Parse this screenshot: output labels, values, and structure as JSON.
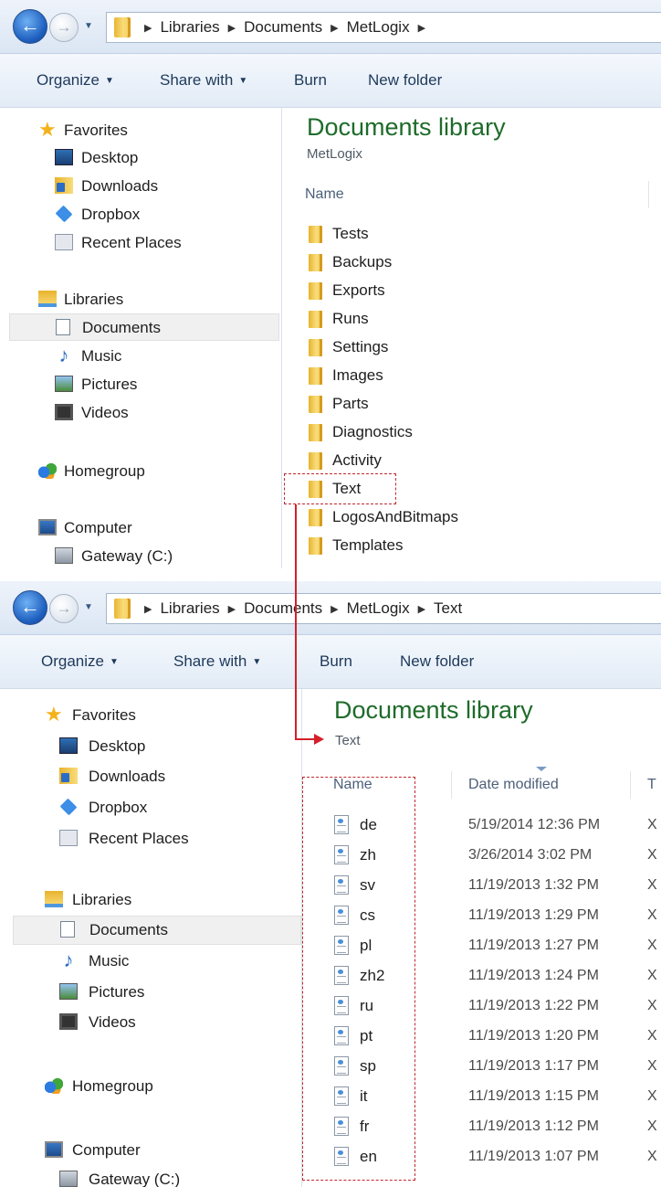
{
  "window1": {
    "breadcrumb": [
      "Libraries",
      "Documents",
      "MetLogix"
    ],
    "toolbar": {
      "organize": "Organize",
      "share_with": "Share with",
      "burn": "Burn",
      "new_folder": "New folder"
    },
    "nav": {
      "favorites": "Favorites",
      "desktop": "Desktop",
      "downloads": "Downloads",
      "dropbox": "Dropbox",
      "recent_places": "Recent Places",
      "libraries": "Libraries",
      "documents": "Documents",
      "music": "Music",
      "pictures": "Pictures",
      "videos": "Videos",
      "homegroup": "Homegroup",
      "computer": "Computer",
      "gateway": "Gateway (C:)"
    },
    "library_title": "Documents library",
    "library_subtitle": "MetLogix",
    "column_name": "Name",
    "folders": [
      "Tests",
      "Backups",
      "Exports",
      "Runs",
      "Settings",
      "Images",
      "Parts",
      "Diagnostics",
      "Activity",
      "Text",
      "LogosAndBitmaps",
      "Templates"
    ]
  },
  "window2": {
    "breadcrumb": [
      "Libraries",
      "Documents",
      "MetLogix",
      "Text"
    ],
    "toolbar": {
      "organize": "Organize",
      "share_with": "Share with",
      "burn": "Burn",
      "new_folder": "New folder"
    },
    "nav": {
      "favorites": "Favorites",
      "desktop": "Desktop",
      "downloads": "Downloads",
      "dropbox": "Dropbox",
      "recent_places": "Recent Places",
      "libraries": "Libraries",
      "documents": "Documents",
      "music": "Music",
      "pictures": "Pictures",
      "videos": "Videos",
      "homegroup": "Homegroup",
      "computer": "Computer",
      "gateway": "Gateway (C:)"
    },
    "library_title": "Documents library",
    "library_subtitle": "Text",
    "columns": {
      "name": "Name",
      "date_modified": "Date modified",
      "type_partial": "T"
    },
    "files": [
      {
        "name": "de",
        "date": "5/19/2014 12:36 PM",
        "type": "X"
      },
      {
        "name": "zh",
        "date": "3/26/2014 3:02 PM",
        "type": "X"
      },
      {
        "name": "sv",
        "date": "11/19/2013 1:32 PM",
        "type": "X"
      },
      {
        "name": "cs",
        "date": "11/19/2013 1:29 PM",
        "type": "X"
      },
      {
        "name": "pl",
        "date": "11/19/2013 1:27 PM",
        "type": "X"
      },
      {
        "name": "zh2",
        "date": "11/19/2013 1:24 PM",
        "type": "X"
      },
      {
        "name": "ru",
        "date": "11/19/2013 1:22 PM",
        "type": "X"
      },
      {
        "name": "pt",
        "date": "11/19/2013 1:20 PM",
        "type": "X"
      },
      {
        "name": "sp",
        "date": "11/19/2013 1:17 PM",
        "type": "X"
      },
      {
        "name": "it",
        "date": "11/19/2013 1:15 PM",
        "type": "X"
      },
      {
        "name": "fr",
        "date": "11/19/2013 1:12 PM",
        "type": "X"
      },
      {
        "name": "en",
        "date": "11/19/2013 1:07 PM",
        "type": "X"
      }
    ]
  },
  "colors": {
    "library_title": "#1e6b2a",
    "highlight": "#c0282e",
    "toolbar_text": "#1e395b"
  }
}
